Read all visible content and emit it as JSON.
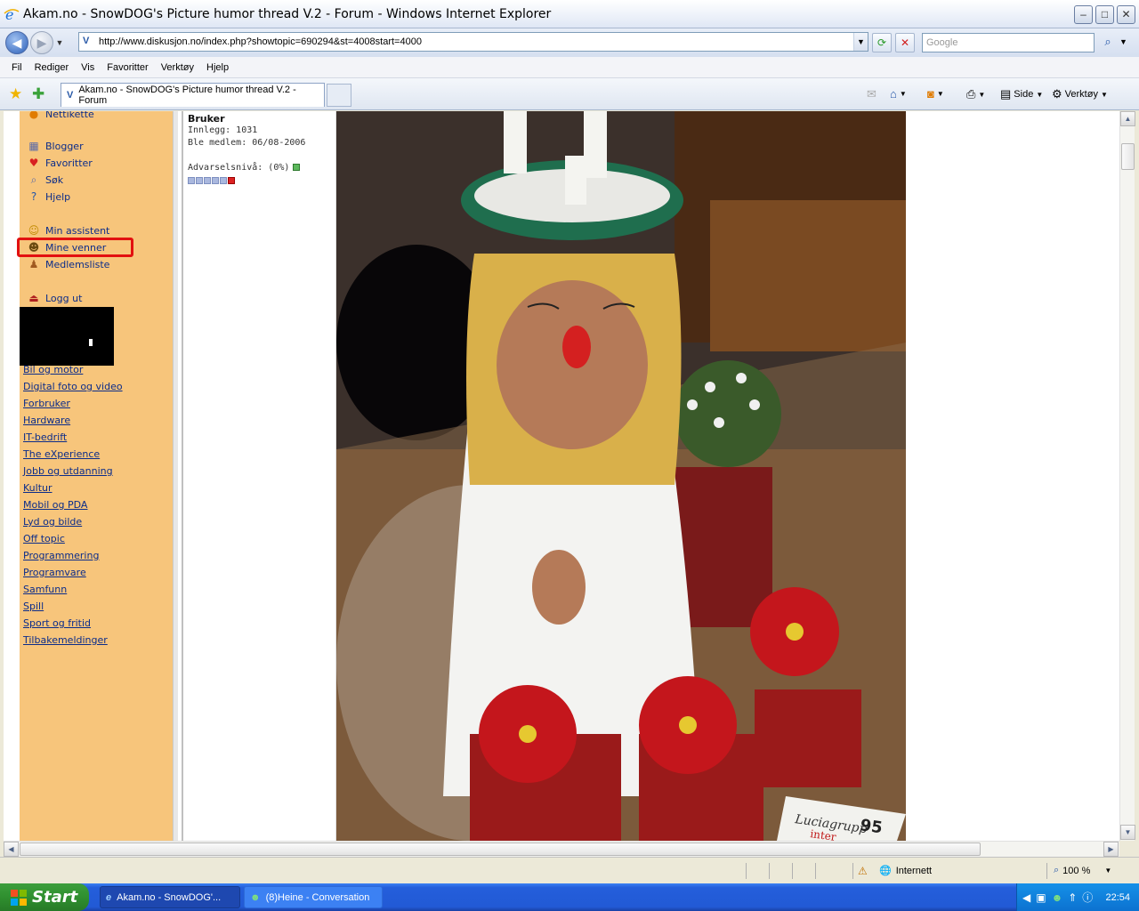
{
  "window": {
    "title": "Akam.no - SnowDOG's Picture humor thread V.2 - Forum - Windows Internet Explorer",
    "icon": "ie-icon"
  },
  "address": {
    "url": "http://www.diskusjon.no/index.php?showtopic=690294&st=4008start=4000",
    "search_placeholder": "Google"
  },
  "menu": [
    "Fil",
    "Rediger",
    "Vis",
    "Favoritter",
    "Verktøy",
    "Hjelp"
  ],
  "tabs": [
    {
      "label": "Akam.no - SnowDOG's Picture humor thread V.2 - Forum"
    }
  ],
  "commands": {
    "page": "Side",
    "tools": "Verktøy"
  },
  "sidebar": {
    "top_partial": "Nettikette",
    "links": [
      {
        "label": "Blogger",
        "icon": "blog-icon"
      },
      {
        "label": "Favoritter",
        "icon": "heart-icon"
      },
      {
        "label": "Søk",
        "icon": "search-icon"
      },
      {
        "label": "Hjelp",
        "icon": "help-icon"
      },
      {
        "label": "Min assistent",
        "icon": "assistant-icon"
      },
      {
        "label": "Mine venner",
        "icon": "friends-icon"
      },
      {
        "label": "Medlemsliste",
        "icon": "members-icon"
      },
      {
        "label": "Logg ut",
        "icon": "logout-icon"
      }
    ],
    "forums": [
      "Bil og motor",
      "Digital foto og video",
      "Forbruker",
      "Hardware",
      "IT-bedrift",
      "The eXperience",
      "Jobb og utdanning",
      "Kultur",
      "Mobil og PDA",
      "Lyd og bilde",
      "Off topic",
      "Programmering",
      "Programvare",
      "Samfunn",
      "Spill",
      "Sport og fritid",
      "Tilbakemeldinger"
    ]
  },
  "user": {
    "role": "Bruker",
    "posts": "Innlegg: 1031",
    "joined": "Ble medlem: 06/08-2006",
    "warning": "Advarselsnivå: (0%)"
  },
  "photo": {
    "sign_text_1": "Luciagrupp",
    "sign_text_2": "inter",
    "sign_number": "95"
  },
  "status": {
    "zone": "Internett",
    "zoom": "100 %"
  },
  "taskbar": {
    "start": "Start",
    "items": [
      "Akam.no - SnowDOG'...",
      "(8)Heine - Conversation"
    ],
    "clock": "22:54"
  },
  "colors": {
    "sidebar_bg": "#f7c57b",
    "link": "#0b2c8a",
    "highlight_ring": "#e21010",
    "taskbar": "#245edb"
  }
}
